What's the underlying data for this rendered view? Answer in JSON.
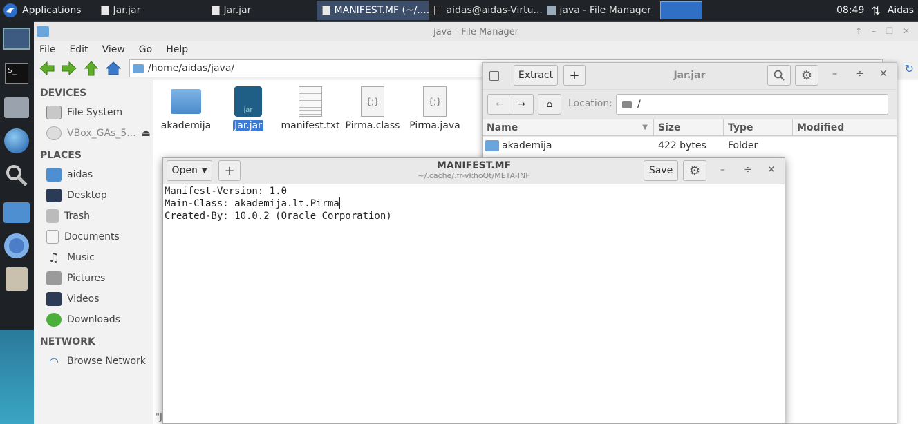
{
  "panel": {
    "apps_label": "Applications",
    "tasks": [
      "Jar.jar",
      "Jar.jar",
      "MANIFEST.MF (~/....",
      "aidas@aidas-Virtu...",
      "java - File Manager"
    ],
    "clock": "08:49",
    "user": "Aidas"
  },
  "file_manager": {
    "title": "java - File Manager",
    "menu": [
      "File",
      "Edit",
      "View",
      "Go",
      "Help"
    ],
    "path": "/home/aidas/java/",
    "sidebar": {
      "devices_header": "DEVICES",
      "devices": [
        "File System",
        "VBox_GAs_5..."
      ],
      "places_header": "PLACES",
      "places": [
        "aidas",
        "Desktop",
        "Trash",
        "Documents",
        "Music",
        "Pictures",
        "Videos",
        "Downloads"
      ],
      "network_header": "NETWORK",
      "network": [
        "Browse Network"
      ]
    },
    "files": [
      {
        "name": "akademija",
        "icon": "folder-icon"
      },
      {
        "name": "Jar.jar",
        "icon": "jar-icon"
      },
      {
        "name": "manifest.txt",
        "icon": "text-file-icon"
      },
      {
        "name": "Pirma.class",
        "icon": "code-file-icon"
      },
      {
        "name": "Pirma.java",
        "icon": "code-file-icon"
      }
    ],
    "jar_icon_text": "jar",
    "code_icon_text": "{;}",
    "status_fragment": "\"J"
  },
  "archive": {
    "title": "Jar.jar",
    "extract_label": "Extract",
    "location_label": "Location:",
    "location_value": "/",
    "columns": [
      "Name",
      "Size",
      "Type",
      "Modified"
    ],
    "rows": [
      {
        "name": "akademija",
        "size": "422 bytes",
        "type": "Folder",
        "modified": ""
      }
    ]
  },
  "editor": {
    "open_label": "Open",
    "title": "MANIFEST.MF",
    "subtitle": "~/.cache/.fr-vkhoQt/META-INF",
    "save_label": "Save",
    "lines": [
      "Manifest-Version: 1.0",
      "Main-Class: akademija.lt.Pirma",
      "Created-By: 10.0.2 (Oracle Corporation)"
    ]
  },
  "colors": {
    "accent": "#3d7bd9",
    "panel": "#202428",
    "folder": "#5b9bd5"
  }
}
